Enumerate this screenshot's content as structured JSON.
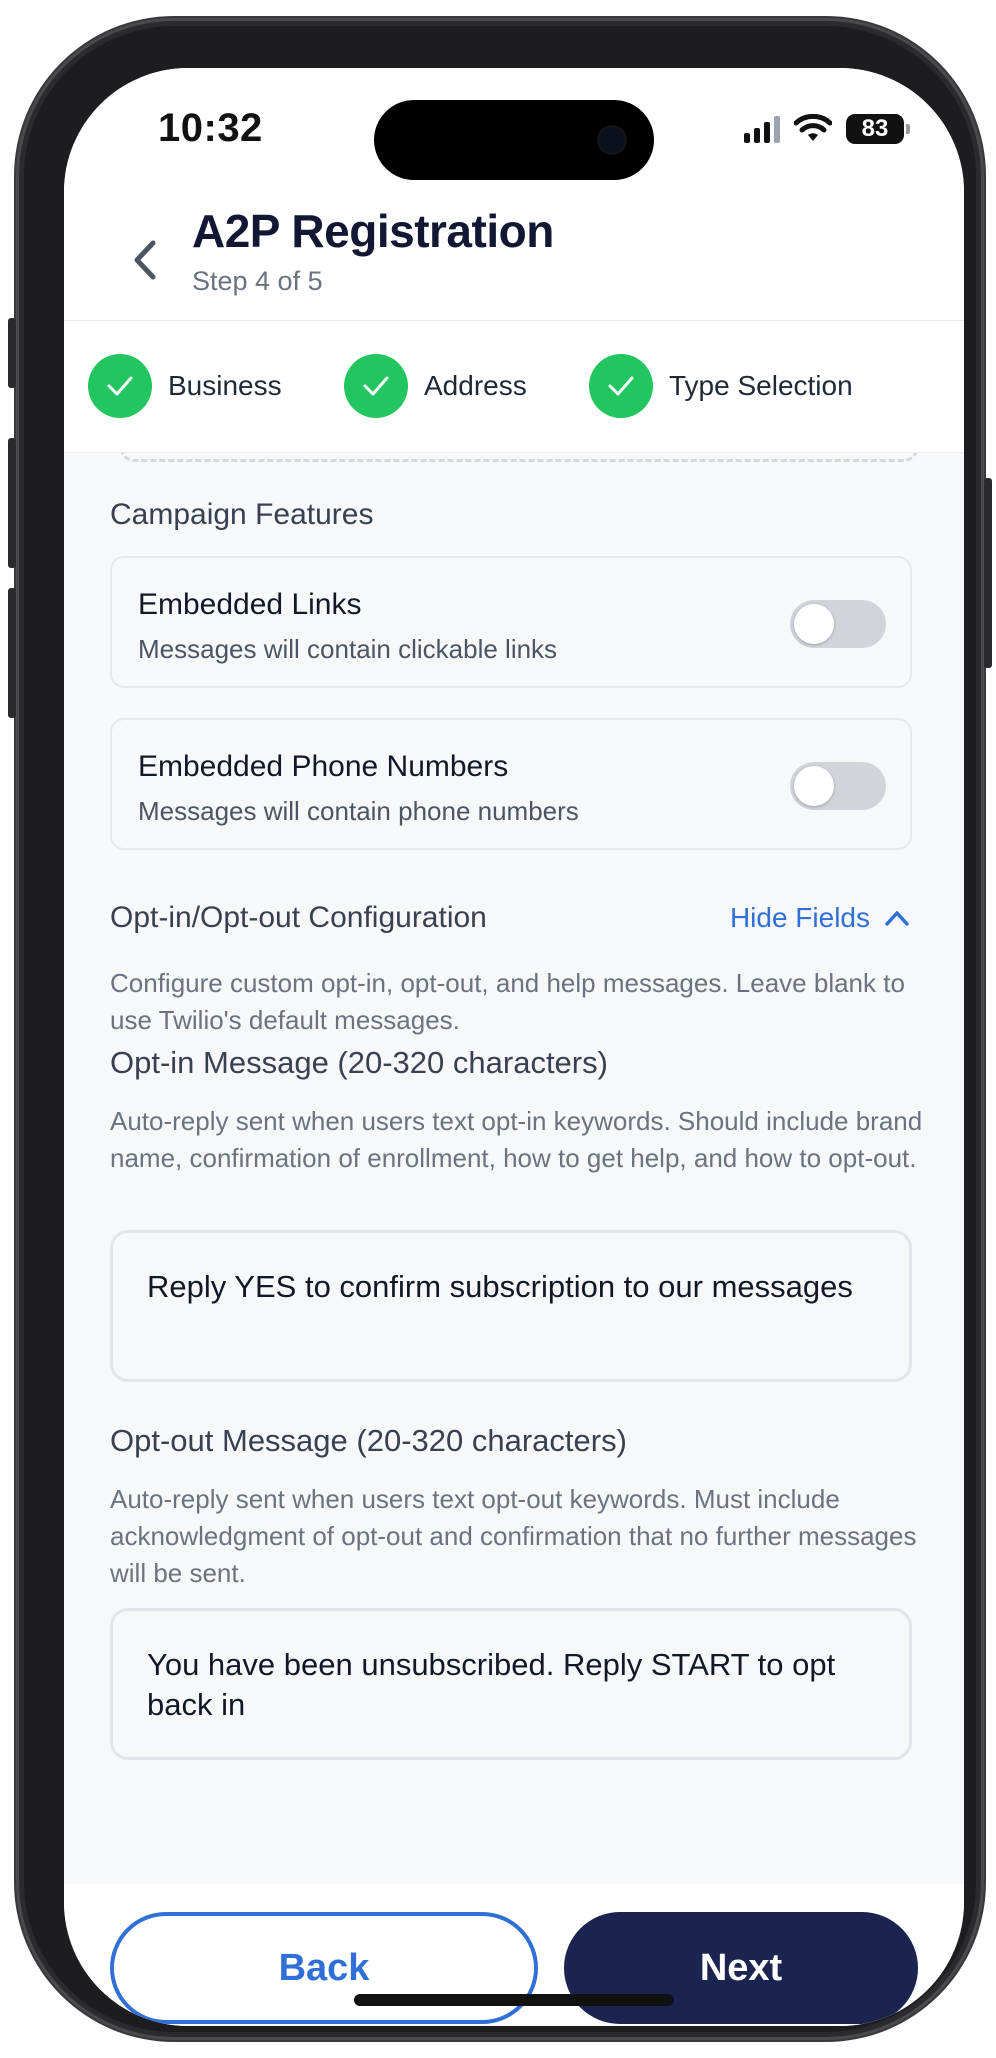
{
  "status_bar": {
    "time": "10:32",
    "battery": "83"
  },
  "header": {
    "title": "A2P Registration",
    "subtitle": "Step 4 of 5"
  },
  "stepper": {
    "steps": [
      {
        "label": "Business",
        "status": "complete"
      },
      {
        "label": "Address",
        "status": "complete"
      },
      {
        "label": "Type Selection",
        "status": "complete"
      }
    ]
  },
  "campaign_features": {
    "title": "Campaign Features",
    "items": [
      {
        "title": "Embedded Links",
        "description": "Messages will contain clickable links",
        "enabled": false
      },
      {
        "title": "Embedded Phone Numbers",
        "description": "Messages will contain phone numbers",
        "enabled": false
      }
    ]
  },
  "opt_config": {
    "title": "Opt-in/Opt-out Configuration",
    "toggle_label": "Hide Fields",
    "description": "Configure custom opt-in, opt-out, and help messages. Leave blank to use Twilio's default messages.",
    "opt_in": {
      "label": "Opt-in Message (20-320 characters)",
      "help": "Auto-reply sent when users text opt-in keywords. Should include brand name, confirmation of enrollment, how to get help, and how to opt-out.",
      "value": "Reply YES to confirm subscription to our messages"
    },
    "opt_out": {
      "label": "Opt-out Message (20-320 characters)",
      "help": "Auto-reply sent when users text opt-out keywords. Must include acknowledgment of opt-out and confirmation that no further messages will be sent.",
      "value": "You have been unsubscribed. Reply START to opt back in"
    }
  },
  "footer": {
    "back_label": "Back",
    "next_label": "Next"
  },
  "colors": {
    "accent_blue": "#2f6fd6",
    "success_green": "#22c55e",
    "primary_navy": "#1b2450"
  },
  "icons": {
    "back": "chevron-left-icon",
    "step_done": "check-icon",
    "collapse": "chevron-up-icon"
  }
}
